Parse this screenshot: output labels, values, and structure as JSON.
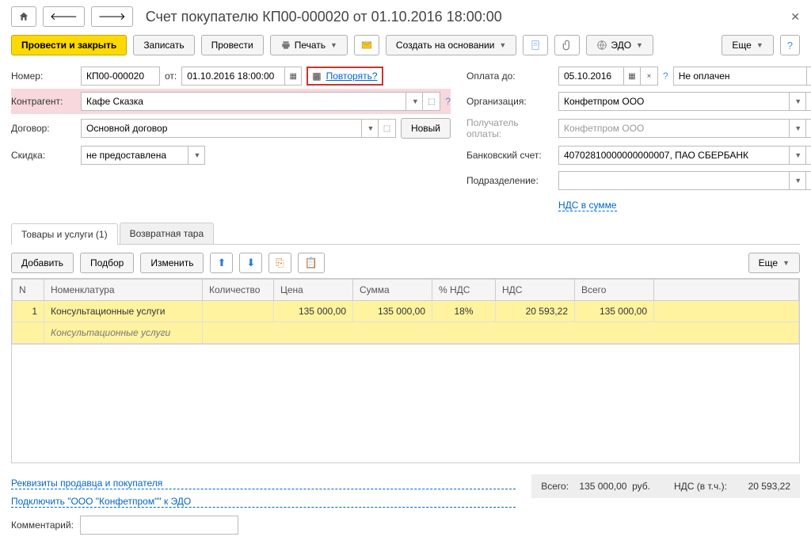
{
  "title": "Счет покупателю КП00-000020 от 01.10.2016 18:00:00",
  "toolbar": {
    "post_close": "Провести и закрыть",
    "write": "Записать",
    "post": "Провести",
    "print": "Печать",
    "create_based": "Создать на основании",
    "edo": "ЭДО",
    "more": "Еще"
  },
  "fields": {
    "number_label": "Номер:",
    "number": "КП00-000020",
    "from_label": "от:",
    "date": "01.10.2016 18:00:00",
    "repeat": "Повторять?",
    "payment_until_label": "Оплата до:",
    "payment_until": "05.10.2016",
    "payment_status": "Не оплачен",
    "counterparty_label": "Контрагент:",
    "counterparty": "Кафе Сказка",
    "organization_label": "Организация:",
    "organization": "Конфетпром ООО",
    "contract_label": "Договор:",
    "contract": "Основной договор",
    "new_btn": "Новый",
    "payee_label": "Получатель оплаты:",
    "payee": "Конфетпром ООО",
    "discount_label": "Скидка:",
    "discount": "не предоставлена",
    "bank_acc_label": "Банковский счет:",
    "bank_acc": "40702810000000000007, ПАО СБЕРБАНК",
    "division_label": "Подразделение:",
    "division": "",
    "vat_mode": "НДС в сумме"
  },
  "tabs": {
    "goods": "Товары и услуги (1)",
    "tare": "Возвратная тара"
  },
  "table_toolbar": {
    "add": "Добавить",
    "pick": "Подбор",
    "change": "Изменить",
    "more": "Еще"
  },
  "columns": {
    "n": "N",
    "nomenclature": "Номенклатура",
    "qty": "Количество",
    "price": "Цена",
    "sum": "Сумма",
    "vat_pct": "% НДС",
    "vat": "НДС",
    "total": "Всего"
  },
  "rows": [
    {
      "n": "1",
      "nomenclature": "Консультационные услуги",
      "sub": "Консультационные услуги",
      "qty": "",
      "price": "135 000,00",
      "sum": "135 000,00",
      "vat_pct": "18%",
      "vat": "20 593,22",
      "total": "135 000,00"
    }
  ],
  "summary": {
    "total_label": "Всего:",
    "total": "135 000,00",
    "currency": "руб.",
    "vat_label": "НДС (в т.ч.):",
    "vat": "20 593,22"
  },
  "footer": {
    "seller_buyer": "Реквизиты продавца и покупателя",
    "connect_edo": "Подключить \"ООО \"Конфетпром\"\" к ЭДО",
    "comment_label": "Комментарий:"
  }
}
